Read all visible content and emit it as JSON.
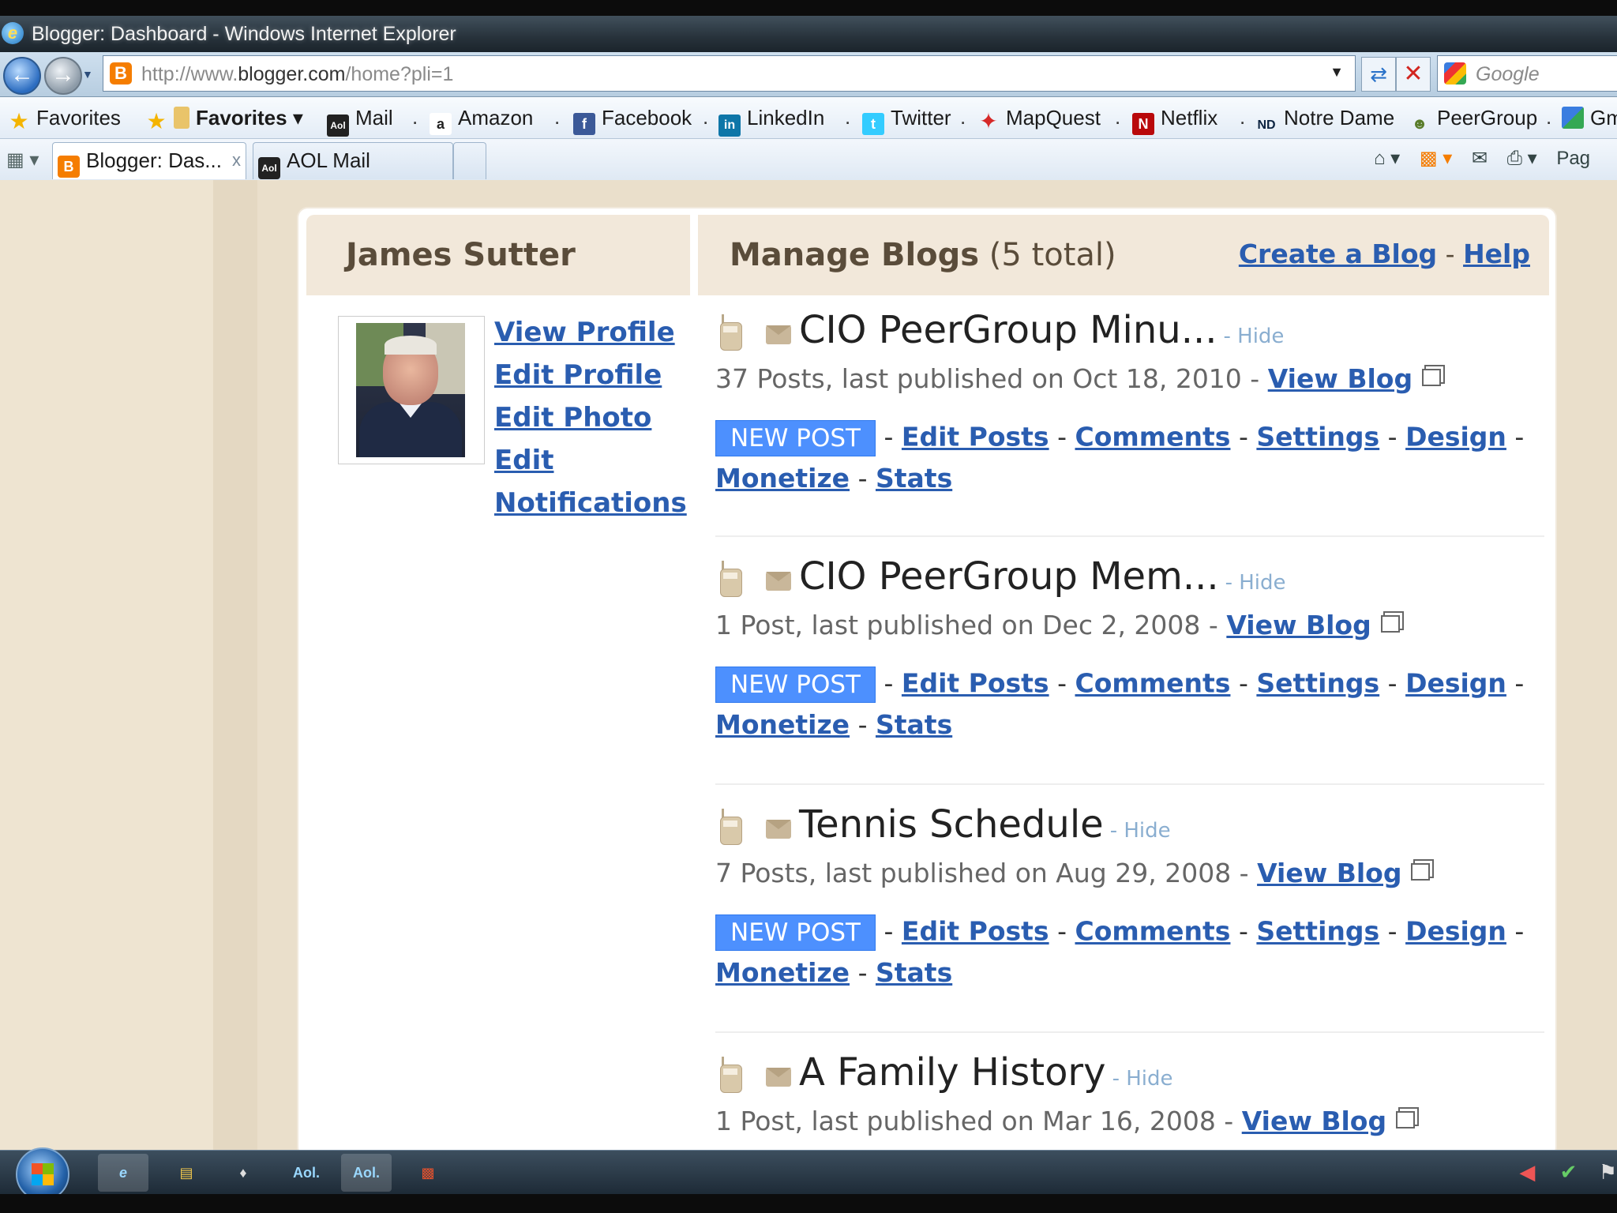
{
  "window": {
    "title": "Blogger: Dashboard - Windows Internet Explorer"
  },
  "address_bar": {
    "url_prefix": "http://www.",
    "url_domain": "blogger.com",
    "url_path": "/home?pli=1",
    "search_placeholder": "Google"
  },
  "favorites_bar": {
    "favorites_label": "Favorites",
    "favorites_menu_label": "Favorites",
    "items": [
      "Mail",
      "Amazon",
      "Facebook",
      "LinkedIn",
      "Twitter",
      "MapQuest",
      "Netflix",
      "Notre Dame",
      "PeerGroup",
      "Gm"
    ]
  },
  "tabs": [
    {
      "label": "Blogger: Das...",
      "active": true
    },
    {
      "label": "AOL Mail",
      "active": false
    }
  ],
  "command_bar": {
    "page_label": "Pag"
  },
  "profile": {
    "name": "James Sutter",
    "links": [
      "View Profile",
      "Edit Profile",
      "Edit Photo",
      "Edit",
      "Notifications"
    ]
  },
  "manage": {
    "title": "Manage Blogs",
    "count": "(5 total)",
    "create_label": "Create a Blog",
    "separator": "-",
    "help_label": "Help"
  },
  "blogs": [
    {
      "name": "CIO PeerGroup Minu...",
      "meta": "37 Posts, last published on Oct 18, 2010 -"
    },
    {
      "name": "CIO PeerGroup Mem...",
      "meta": "1 Post, last published on Dec 2, 2008 -"
    },
    {
      "name": "Tennis Schedule",
      "meta": "7 Posts, last published on Aug 29, 2008 -"
    },
    {
      "name": "A Family History",
      "meta": "1 Post, last published on Mar 16, 2008 -"
    }
  ],
  "blog_actions": {
    "hide": "- Hide",
    "view_blog": "View Blog",
    "new_post": "NEW POST",
    "edit_posts": "Edit Posts",
    "comments": "Comments",
    "settings": "Settings",
    "design": "Design",
    "monetize": "Monetize",
    "stats": "Stats",
    "dash": "-"
  }
}
